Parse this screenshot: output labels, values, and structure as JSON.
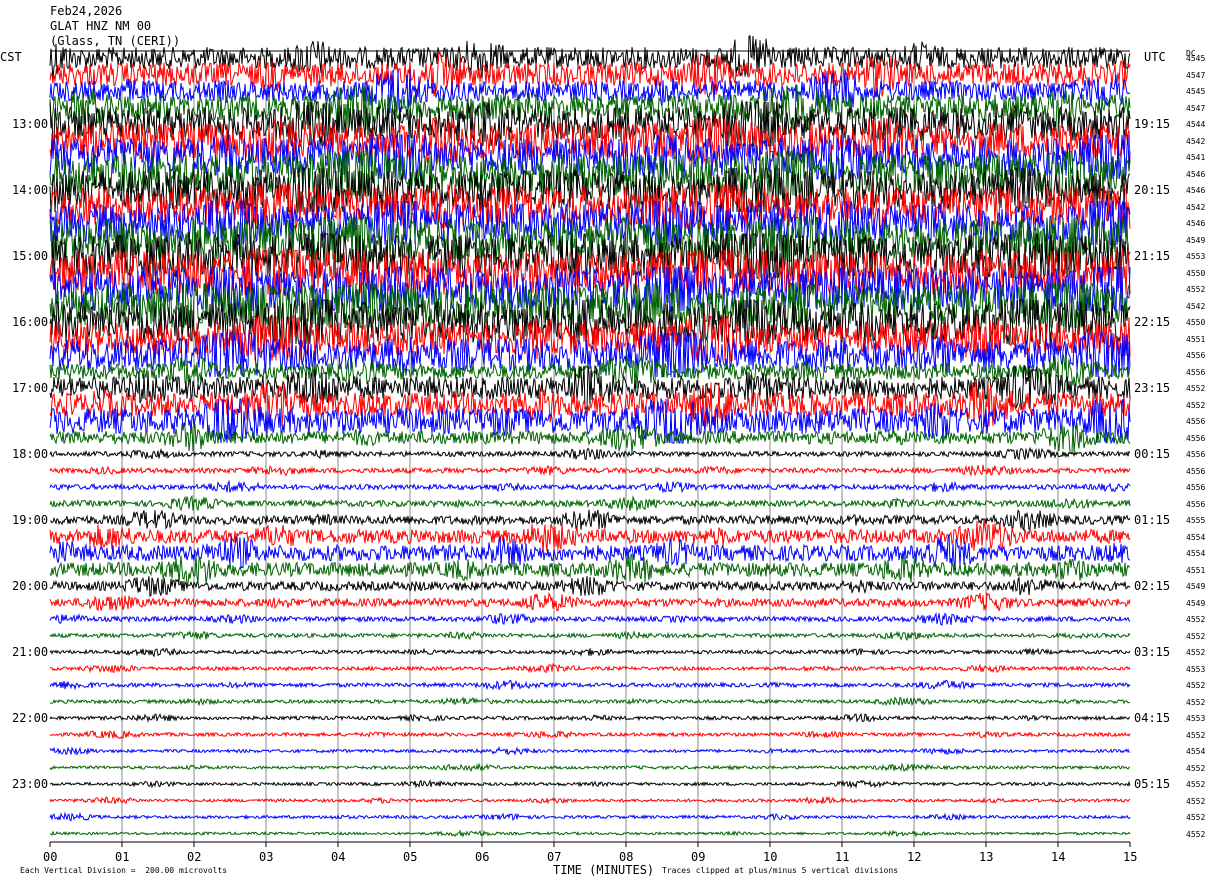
{
  "header": {
    "date": "Feb24,2026",
    "station": "GLAT HNZ NM 00",
    "location": "(Glass, TN (CERI))"
  },
  "axes": {
    "left_label": "CST",
    "right_label": "UTC",
    "dc_label": "DC",
    "xlabel": "TIME (MINUTES)"
  },
  "footer": {
    "scale_note": "Each Vertical Division =  200.00 microvolts",
    "clip_note": "Traces clipped at plus/minus 5 vertical divisions"
  },
  "chart_data": {
    "type": "line",
    "xlim": [
      0,
      15
    ],
    "x_ticks": [
      "00",
      "01",
      "02",
      "03",
      "04",
      "05",
      "06",
      "07",
      "08",
      "09",
      "10",
      "11",
      "12",
      "13",
      "14",
      "15"
    ],
    "left_time_labels": [
      "13:00",
      "14:00",
      "15:00",
      "16:00",
      "17:00",
      "18:00",
      "19:00",
      "20:00",
      "21:00",
      "22:00",
      "23:00"
    ],
    "right_time_labels": [
      "19:15",
      "20:15",
      "21:15",
      "22:15",
      "23:15",
      "00:15",
      "01:15",
      "02:15",
      "03:15",
      "04:15",
      "05:15"
    ],
    "trace_colors": [
      "#000000",
      "#ff0000",
      "#0000ff",
      "#006400"
    ],
    "trace_count": 48,
    "traces_per_hour": 4,
    "dc_values": [
      "4545",
      "4547",
      "4545",
      "4547",
      "4544",
      "4542",
      "4541",
      "4546",
      "4546",
      "4542",
      "4546",
      "4549",
      "4553",
      "4550",
      "4552",
      "4542",
      "4550",
      "4551",
      "4556",
      "4556",
      "4552",
      "4552",
      "4556",
      "4556",
      "4556",
      "4556",
      "4556",
      "4556",
      "4555",
      "4554",
      "4554",
      "4551",
      "4549",
      "4549",
      "4552",
      "4552",
      "4552",
      "4553",
      "4552",
      "4552",
      "4553",
      "4552",
      "4554",
      "4552",
      "4552",
      "4552",
      "4552",
      "4552"
    ],
    "amplitude": [
      2.2,
      2.4,
      2.1,
      2.6,
      3.4,
      3.6,
      3.8,
      3.9,
      3.9,
      4.0,
      3.9,
      4.1,
      4.3,
      4.4,
      4.3,
      4.2,
      4.1,
      3.3,
      3.3,
      1.6,
      2.3,
      2.4,
      2.6,
      1.3,
      0.5,
      0.5,
      0.5,
      0.6,
      0.9,
      1.4,
      1.6,
      1.4,
      0.9,
      0.8,
      0.5,
      0.4,
      0.35,
      0.35,
      0.4,
      0.35,
      0.35,
      0.35,
      0.3,
      0.3,
      0.3,
      0.3,
      0.3,
      0.25
    ]
  }
}
